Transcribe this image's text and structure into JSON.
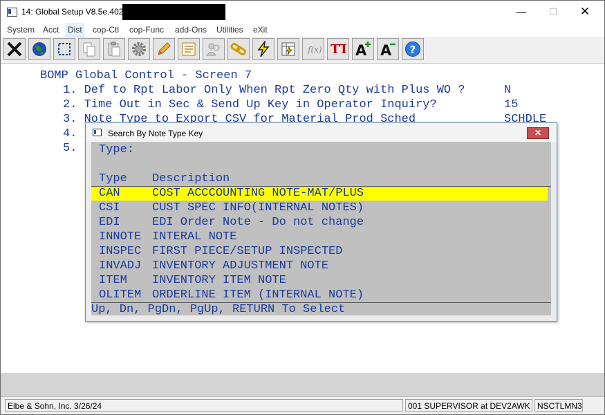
{
  "window": {
    "title": "14: Global Setup V8.5e.402 -",
    "minimize_glyph": "—",
    "maximize_glyph": "☐",
    "close_glyph": "✕"
  },
  "menu": {
    "items": [
      {
        "label": "System"
      },
      {
        "label": "Acct"
      },
      {
        "label": "Dist",
        "active": true
      },
      {
        "label": "cop-Ctl"
      },
      {
        "label": "cop-Func"
      },
      {
        "label": "add-Ons"
      },
      {
        "label": "Utilities"
      },
      {
        "label": "eXit"
      }
    ]
  },
  "toolbar": {
    "buttons": [
      {
        "icon": "close-x-icon"
      },
      {
        "icon": "globe-icon"
      },
      {
        "icon": "select-box-icon"
      },
      {
        "icon": "copy-icon"
      },
      {
        "icon": "paste-icon"
      },
      {
        "icon": "settings-gear-icon"
      },
      {
        "icon": "edit-pencil-icon"
      },
      {
        "icon": "notes-icon"
      },
      {
        "icon": "users-icon"
      },
      {
        "icon": "link-icon"
      },
      {
        "icon": "lightning-icon"
      },
      {
        "icon": "spreadsheet-icon"
      },
      {
        "icon": "formula-icon"
      },
      {
        "icon": "font-icon"
      },
      {
        "icon": "font-increase-icon"
      },
      {
        "icon": "font-decrease-icon"
      },
      {
        "icon": "help-icon"
      }
    ],
    "font_label": "TT",
    "font_up_label": "A",
    "font_down_label": "A",
    "help_label": "?"
  },
  "screen": {
    "title": "BOMP Global Control - Screen 7",
    "lines": [
      {
        "prompt": "1. Def to Rpt Labor Only When Rpt Zero Qty with Plus WO ?",
        "value": "N"
      },
      {
        "prompt": "2. Time Out in Sec & Send Up Key in Operator Inquiry?",
        "value": "15"
      },
      {
        "prompt": "3. Note Type to Export CSV for Material Prod Sched",
        "value": "SCHDLE"
      },
      {
        "prompt": "4.",
        "value": ""
      },
      {
        "prompt": "5.",
        "value": ""
      }
    ]
  },
  "dialog": {
    "title": "Search By Note Type Key",
    "close_glyph": "✕",
    "type_label": "Type:",
    "col_type": "Type",
    "col_desc": "Description",
    "rows": [
      {
        "type": "CAN",
        "desc": "COST ACCCOUNTING NOTE-MAT/PLUS",
        "selected": true
      },
      {
        "type": "CSI",
        "desc": "CUST SPEC INFO(INTERNAL NOTES)"
      },
      {
        "type": "EDI",
        "desc": "EDI Order Note - Do not change"
      },
      {
        "type": "INNOTE",
        "desc": "INTERAL NOTE"
      },
      {
        "type": "INSPEC",
        "desc": "FIRST PIECE/SETUP INSPECTED"
      },
      {
        "type": "INVADJ",
        "desc": "INVENTORY ADJUSTMENT NOTE"
      },
      {
        "type": "ITEM",
        "desc": "INVENTORY ITEM NOTE"
      },
      {
        "type": "OLITEM",
        "desc": "ORDERLINE ITEM (INTERNAL NOTE)"
      }
    ],
    "footer": "Up, Dn, PgDn, PgUp, RETURN To Select"
  },
  "status": {
    "company": "Elbe & Sohn, Inc. 3/26/24",
    "user": "001 SUPERVISOR at DEV2AWK",
    "program": "NSCTLMN3"
  }
}
